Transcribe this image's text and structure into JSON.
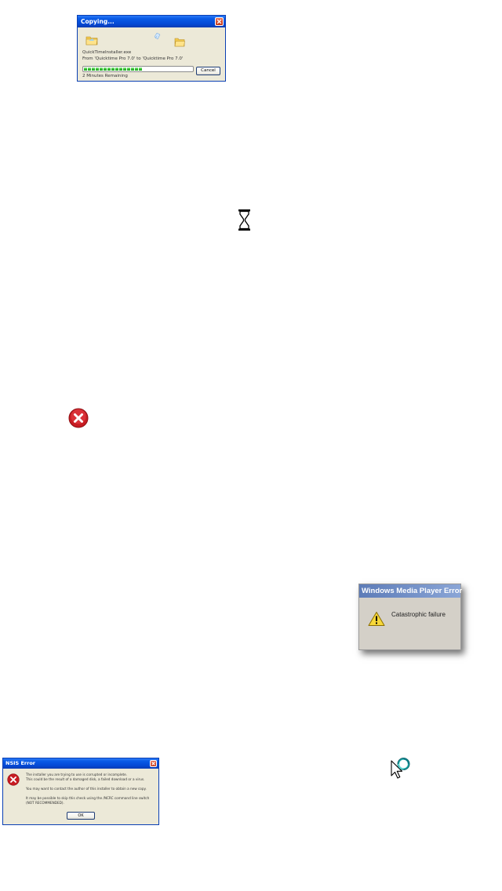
{
  "copying_dialog": {
    "title": "Copying...",
    "file_name": "QuickTimeInstaller.exe",
    "from_to": "From 'Quicktime Pro 7.0' to 'Quicktime Pro 7.0'",
    "progress_fraction": 0.55,
    "status": "2 Minutes Remaining",
    "cancel_label": "Cancel"
  },
  "wmp_error": {
    "title": "Windows Media Player Error",
    "message": "Catastrophic failure"
  },
  "nsis_error": {
    "title": "NSIS Error",
    "line1": "The installer you are trying to use is corrupted or incomplete.",
    "line2": "This could be the result of a damaged disk, a failed download or a virus.",
    "line3": "You may want to contact the author of this installer to obtain a new copy.",
    "line4": "It may be possible to skip this check using the /NCRC command line switch",
    "line5": "(NOT RECOMMENDED).",
    "ok_label": "OK"
  },
  "icons": {
    "hourglass": "hourglass-icon",
    "error": "error-icon",
    "busy_cursor": "busy-cursor-icon"
  },
  "colors": {
    "xp_title_blue": "#0449d6",
    "xp_face": "#ece9d8",
    "error_red": "#d7262a",
    "warning_yellow": "#f7d83a",
    "progress_green": "#3bc33b",
    "cursor_teal": "#18a0a0"
  }
}
